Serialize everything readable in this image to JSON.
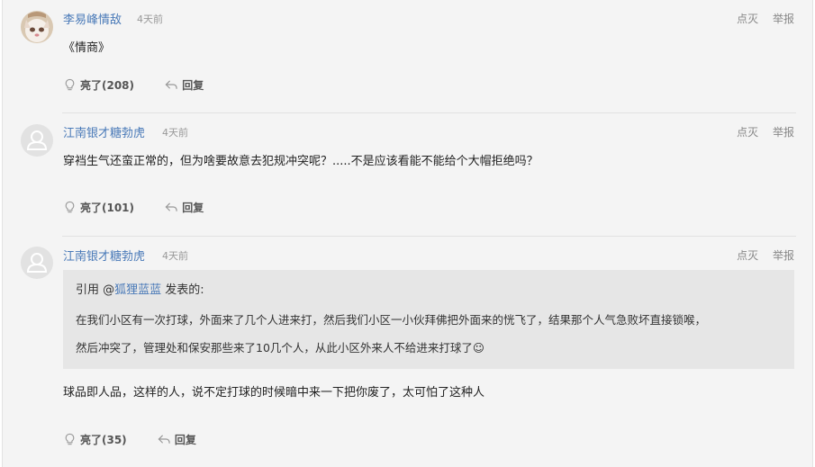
{
  "comments": [
    {
      "username": "李易峰情敌",
      "time": "4天前",
      "ops": {
        "downvote": "点灭",
        "report": "举报"
      },
      "text": "《情商》",
      "like_label": "亮了(208)",
      "reply_label": "回复"
    },
    {
      "username": "江南银才糖勃虎",
      "time": "4天前",
      "ops": {
        "downvote": "点灭",
        "report": "举报"
      },
      "text": "穿裆生气还蛮正常的，但为啥要故意去犯规冲突呢？.....不是应该看能不能给个大帽拒绝吗？",
      "like_label": "亮了(101)",
      "reply_label": "回复"
    },
    {
      "username": "江南银才糖勃虎",
      "time": "4天前",
      "ops": {
        "downvote": "点灭",
        "report": "举报"
      },
      "quote": {
        "prefix": "引用 @",
        "user": "狐狸蓝蓝",
        "suffix": " 发表的:",
        "line1": "在我们小区有一次打球，外面来了几个人进来打，然后我们小区一小伙拜佛把外面来的恍飞了，结果那个人气急败坏直接锁喉，",
        "line2": "然后冲突了，管理处和保安那些来了10几个人，从此小区外来人不给进来打球了☺"
      },
      "text": "球品即人品，这样的人，说不定打球的时候暗中来一下把你废了，太可怕了这种人",
      "like_label": "亮了(35)",
      "reply_label": "回复"
    }
  ]
}
